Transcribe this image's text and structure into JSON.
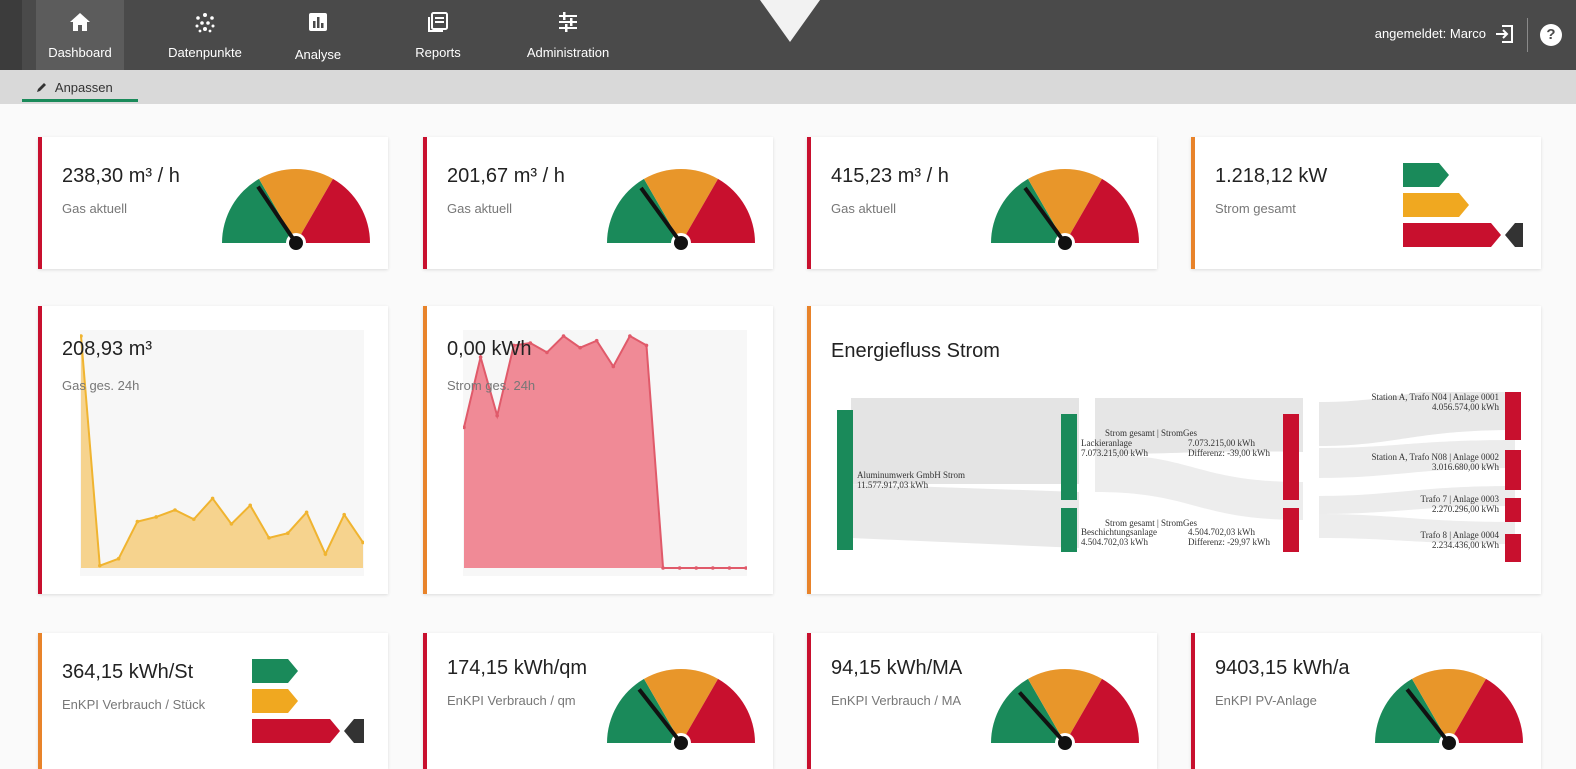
{
  "nav": {
    "items": [
      {
        "label": "Dashboard",
        "icon": "home-icon"
      },
      {
        "label": "Datenpunkte",
        "icon": "datapoints-icon"
      },
      {
        "label": "Analyse",
        "icon": "chart-icon"
      },
      {
        "label": "Reports",
        "icon": "reports-icon"
      },
      {
        "label": "Administration",
        "icon": "sliders-icon"
      }
    ],
    "login_text": "angemeldet: Marco",
    "help": "?"
  },
  "subnav": {
    "customize_label": "Anpassen"
  },
  "colors": {
    "green": "#1a8a5a",
    "orange": "#e8962a",
    "red": "#c8102e",
    "dark": "#4a4a4a"
  },
  "cards": {
    "gas1": {
      "value": "238,30 m³ / h",
      "label": "Gas aktuell"
    },
    "gas2": {
      "value": "201,67 m³ / h",
      "label": "Gas aktuell"
    },
    "gas3": {
      "value": "415,23 m³ / h",
      "label": "Gas aktuell"
    },
    "strom": {
      "value": "1.218,12 kW",
      "label": "Strom gesamt"
    },
    "gas24": {
      "value": "208,93 m³",
      "label": "Gas ges. 24h"
    },
    "strom24": {
      "value": "0,00 kWh",
      "label": "Strom ges. 24h"
    },
    "energiefluss": {
      "title": "Energiefluss Strom"
    },
    "kpi1": {
      "value": "364,15 kWh/St",
      "label": "EnKPI Verbrauch / Stück"
    },
    "kpi2": {
      "value": "174,15 kWh/qm",
      "label": "EnKPI Verbrauch / qm"
    },
    "kpi3": {
      "value": "94,15 kWh/MA",
      "label": "EnKPI Verbrauch / MA"
    },
    "kpi4": {
      "value": "9403,15 kWh/a",
      "label": "EnKPI PV-Anlage"
    }
  },
  "sankey": {
    "source": {
      "name": "Aluminumwerk GmbH Strom",
      "value": "11.577.917,03 kWh"
    },
    "mid": [
      {
        "header": "Strom gesamt | StromGes",
        "name": "Lackieranlage",
        "left_value": "7.073.215,00 kWh",
        "right_value": "7.073.215,00 kWh",
        "diff": "Differenz: -39,00 kWh"
      },
      {
        "header": "Strom gesamt | StromGes",
        "name": "Beschichtungsanlage",
        "left_value": "4.504.702,03 kWh",
        "right_value": "4.504.702,03 kWh",
        "diff": "Differenz: -29,97 kWh"
      }
    ],
    "targets": [
      {
        "name": "Station A, Trafo N04 | Anlage 0001",
        "value": "4.056.574,00 kWh"
      },
      {
        "name": "Station A, Trafo N08 | Anlage 0002",
        "value": "3.016.680,00 kWh"
      },
      {
        "name": "Trafo 7 | Anlage 0003",
        "value": "2.270.296,00 kWh"
      },
      {
        "name": "Trafo 8 | Anlage 0004",
        "value": "2.234.436,00 kWh"
      }
    ]
  },
  "chart_data": [
    {
      "type": "area",
      "series": [
        {
          "values": [
            100,
            1,
            4,
            20,
            22,
            25,
            21,
            30,
            19,
            27,
            13,
            15,
            24,
            6,
            23,
            11
          ]
        }
      ]
    },
    {
      "type": "area",
      "series": [
        {
          "values": [
            60,
            90,
            65,
            95,
            96,
            92,
            99,
            94,
            97,
            86,
            99,
            95,
            0,
            0,
            0,
            0,
            0,
            0
          ]
        }
      ]
    }
  ]
}
